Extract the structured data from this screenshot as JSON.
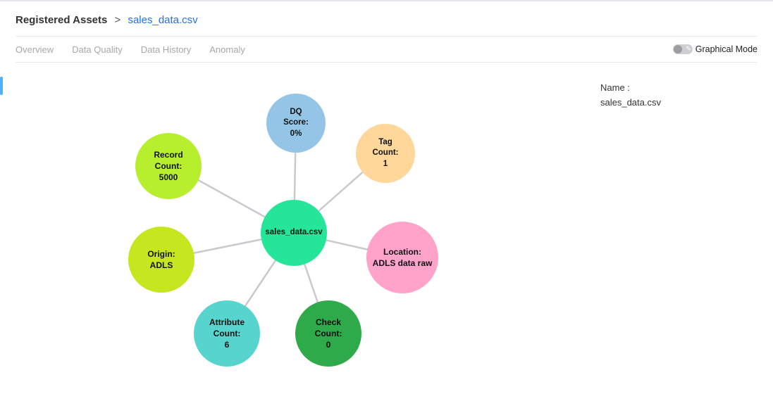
{
  "breadcrumb": {
    "root": "Registered Assets",
    "sep": ">",
    "current": "sales_data.csv"
  },
  "tabs": {
    "t0": "Overview",
    "t1": "Data Quality",
    "t2": "Data History",
    "t3": "Anomaly"
  },
  "toggle": {
    "label": "Graphical Mode"
  },
  "side": {
    "name_label": "Name :",
    "name_value": "sales_data.csv"
  },
  "chart_data": {
    "type": "radial-node",
    "center": {
      "label": "sales_data.csv"
    },
    "nodes": [
      {
        "id": "record-count",
        "label_top": "Record",
        "label_mid": "Count:",
        "value": "5000",
        "color": "#b7ef2f"
      },
      {
        "id": "dq-score",
        "label_top": "DQ",
        "label_mid": "Score:",
        "value": "0%",
        "color": "#94c5e6"
      },
      {
        "id": "tag-count",
        "label_top": "Tag",
        "label_mid": "Count:",
        "value": "1",
        "color": "#ffd79a"
      },
      {
        "id": "location",
        "label_top": "Location:",
        "label_mid": "",
        "value": "ADLS data raw",
        "color": "#ffa3ca"
      },
      {
        "id": "check-count",
        "label_top": "Check",
        "label_mid": "Count:",
        "value": "0",
        "color": "#2faa4b"
      },
      {
        "id": "attribute-count",
        "label_top": "Attribute",
        "label_mid": "Count:",
        "value": "6",
        "color": "#56d4cd"
      },
      {
        "id": "origin",
        "label_top": "Origin:",
        "label_mid": "",
        "value": "ADLS",
        "color": "#c6e71f"
      }
    ]
  }
}
